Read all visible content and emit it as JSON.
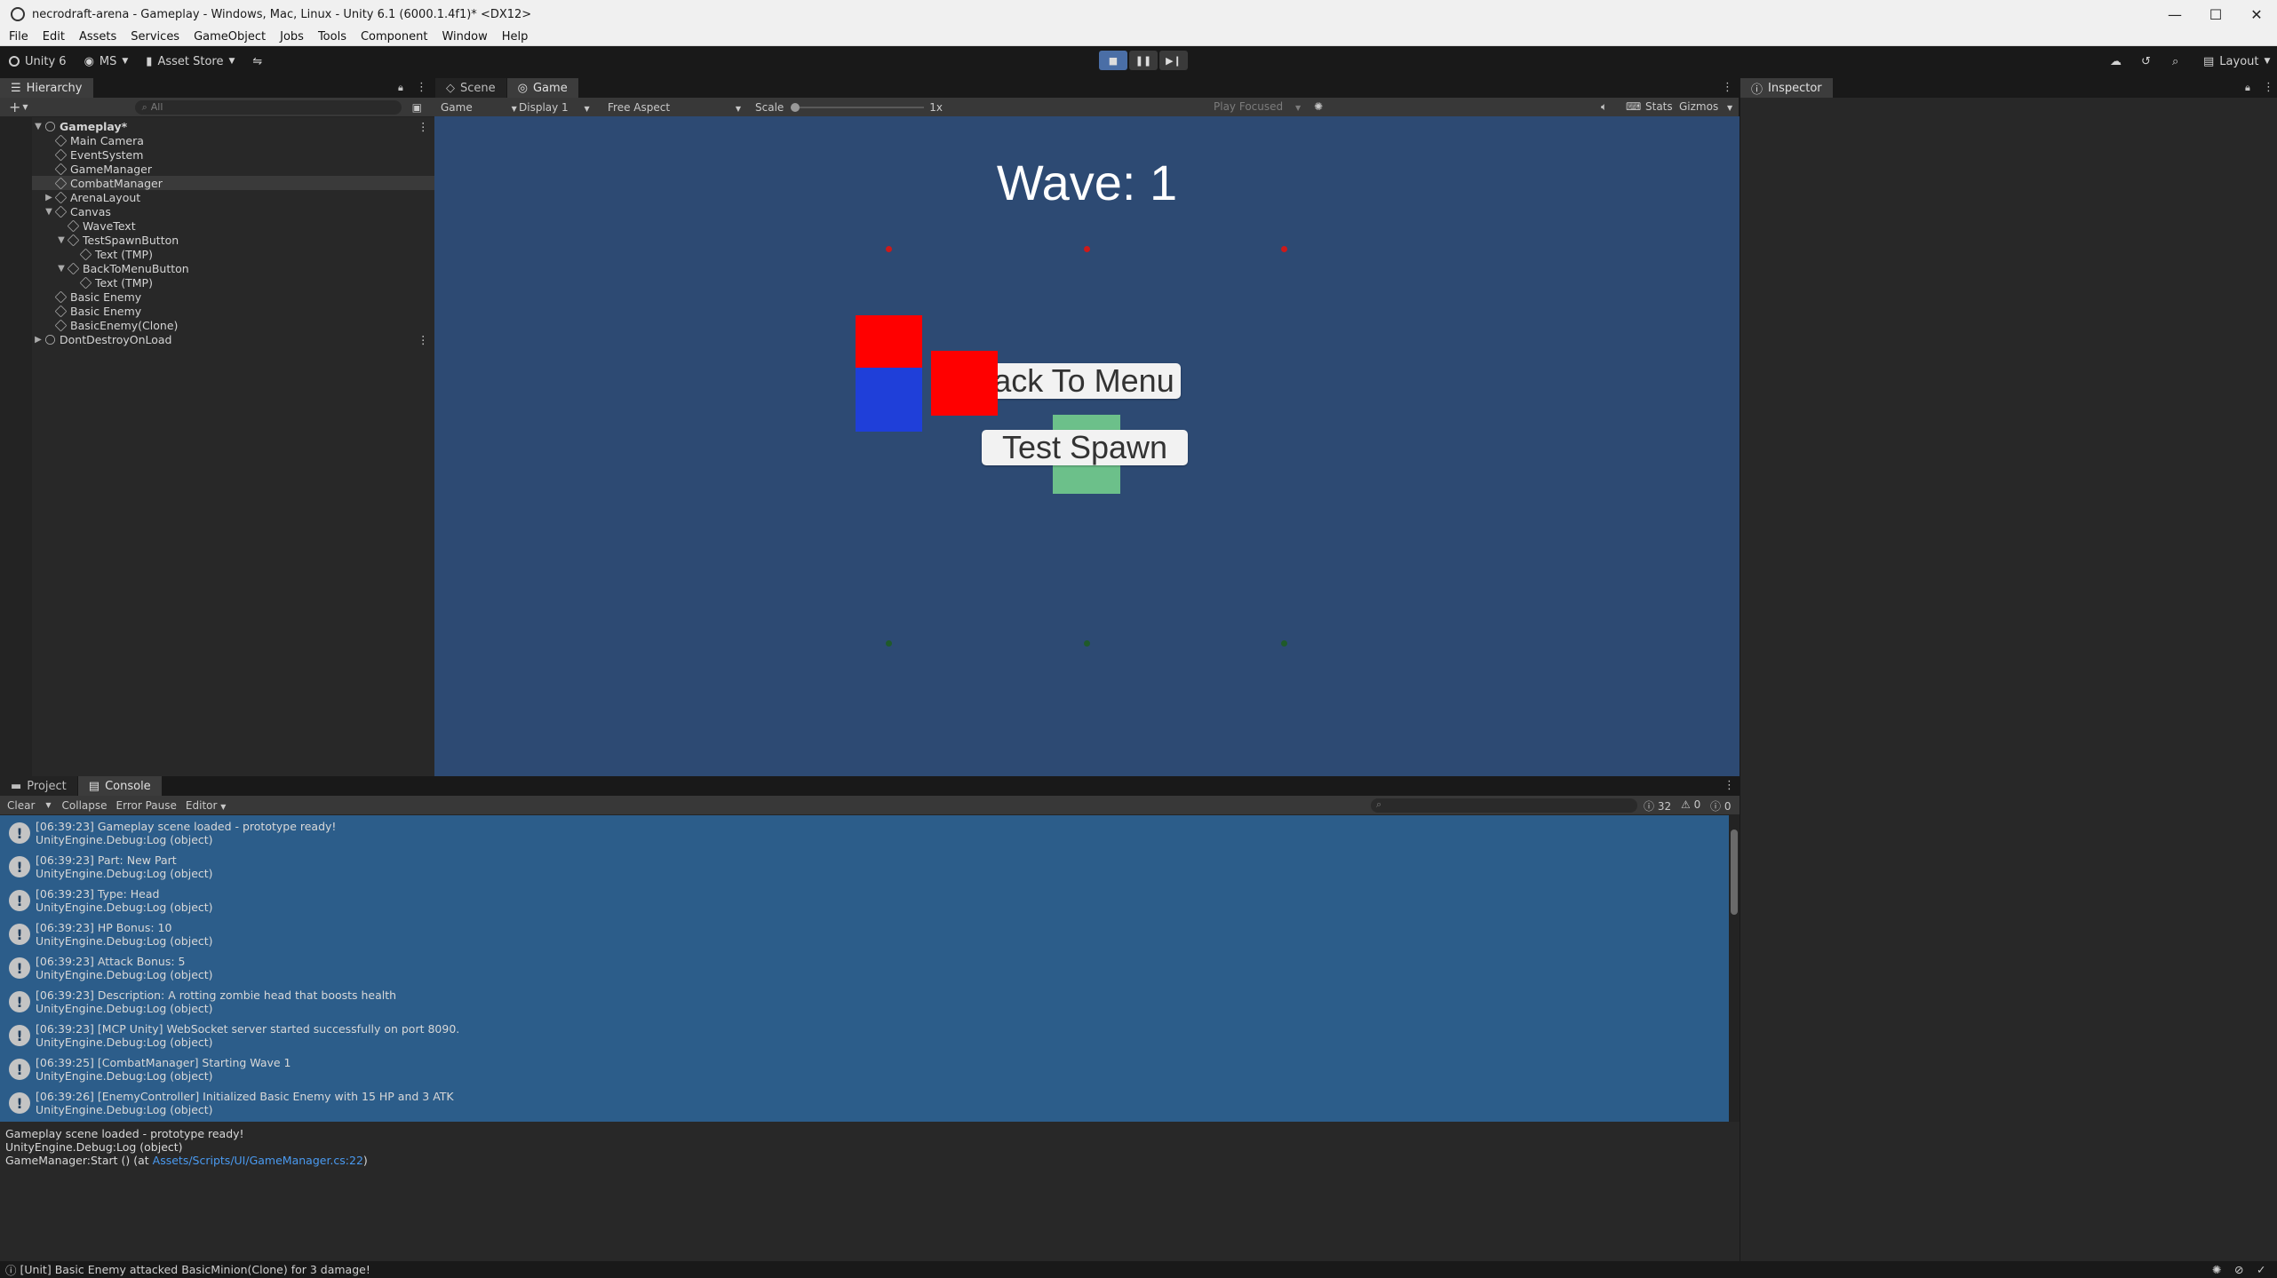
{
  "window": {
    "title": "necrodraft-arena - Gameplay - Windows, Mac, Linux - Unity 6.1 (6000.1.4f1)* <DX12>",
    "minimize": "—",
    "maximize": "☐",
    "close": "✕"
  },
  "menu": [
    "File",
    "Edit",
    "Assets",
    "Services",
    "GameObject",
    "Jobs",
    "Tools",
    "Component",
    "Window",
    "Help"
  ],
  "toolbar": {
    "unity_label": "Unity 6",
    "account_label": "MS",
    "asset_store_label": "Asset Store",
    "layout_label": "Layout"
  },
  "hierarchy": {
    "tab_label": "Hierarchy",
    "search_placeholder": "All",
    "items": [
      {
        "label": "Gameplay*",
        "depth": 0,
        "scene": true,
        "expanded": true
      },
      {
        "label": "Main Camera",
        "depth": 1
      },
      {
        "label": "EventSystem",
        "depth": 1
      },
      {
        "label": "GameManager",
        "depth": 1
      },
      {
        "label": "CombatManager",
        "depth": 1,
        "selected": true
      },
      {
        "label": "ArenaLayout",
        "depth": 1,
        "collapsed": true
      },
      {
        "label": "Canvas",
        "depth": 1,
        "expanded": true
      },
      {
        "label": "WaveText",
        "depth": 2
      },
      {
        "label": "TestSpawnButton",
        "depth": 2,
        "expanded": true
      },
      {
        "label": "Text (TMP)",
        "depth": 3
      },
      {
        "label": "BackToMenuButton",
        "depth": 2,
        "expanded": true
      },
      {
        "label": "Text (TMP)",
        "depth": 3
      },
      {
        "label": "Basic Enemy",
        "depth": 1
      },
      {
        "label": "Basic Enemy",
        "depth": 1
      },
      {
        "label": "BasicEnemy(Clone)",
        "depth": 1
      },
      {
        "label": "DontDestroyOnLoad",
        "depth": 0,
        "scene": true,
        "collapsed": true
      }
    ]
  },
  "game": {
    "tab_scene": "Scene",
    "tab_game": "Game",
    "mode": "Game",
    "display": "Display 1",
    "aspect": "Free Aspect",
    "scale_label": "Scale",
    "scale_value": "1x",
    "play_focused": "Play Focused",
    "stats": "Stats",
    "gizmos": "Gizmos",
    "wave_text": "Wave: 1",
    "back_button": "Back To Menu",
    "spawn_button": "Test Spawn",
    "colors": {
      "background": "#2d4a73",
      "enemy": "#ff0000",
      "player": "#1f3fd9",
      "minion": "#6cc08a",
      "spawn_dot_red": "#cc1a1a",
      "spawn_dot_green": "#1f5a2a"
    }
  },
  "inspector": {
    "tab_label": "Inspector"
  },
  "console": {
    "tab_project": "Project",
    "tab_console": "Console",
    "clear": "Clear",
    "collapse": "Collapse",
    "error_pause": "Error Pause",
    "editor": "Editor",
    "counts": {
      "log": "32",
      "warn": "0",
      "error": "0"
    },
    "entries": [
      {
        "line1": "[06:39:23] Gameplay scene loaded - prototype ready!",
        "line2": "UnityEngine.Debug:Log (object)"
      },
      {
        "line1": "[06:39:23] Part: New Part",
        "line2": "UnityEngine.Debug:Log (object)"
      },
      {
        "line1": "[06:39:23] Type: Head",
        "line2": "UnityEngine.Debug:Log (object)"
      },
      {
        "line1": "[06:39:23] HP Bonus: 10",
        "line2": "UnityEngine.Debug:Log (object)"
      },
      {
        "line1": "[06:39:23] Attack Bonus: 5",
        "line2": "UnityEngine.Debug:Log (object)"
      },
      {
        "line1": "[06:39:23] Description: A rotting zombie head that boosts health",
        "line2": "UnityEngine.Debug:Log (object)"
      },
      {
        "line1": "[06:39:23] [MCP Unity] WebSocket server started successfully on port 8090.",
        "line2": "UnityEngine.Debug:Log (object)"
      },
      {
        "line1": "[06:39:25] [CombatManager] Starting Wave 1",
        "line2": "UnityEngine.Debug:Log (object)"
      },
      {
        "line1": "[06:39:26] [EnemyController] Initialized Basic Enemy with 15 HP and 3 ATK",
        "line2": "UnityEngine.Debug:Log (object)"
      }
    ],
    "detail": {
      "line1": "Gameplay scene loaded - prototype ready!",
      "line2": "UnityEngine.Debug:Log (object)",
      "line3_prefix": "GameManager:Start () (at ",
      "line3_link": "Assets/Scripts/UI/GameManager.cs:22",
      "line3_suffix": ")"
    }
  },
  "status": {
    "message": "[Unit] Basic Enemy attacked BasicMinion(Clone) for 3 damage!"
  }
}
